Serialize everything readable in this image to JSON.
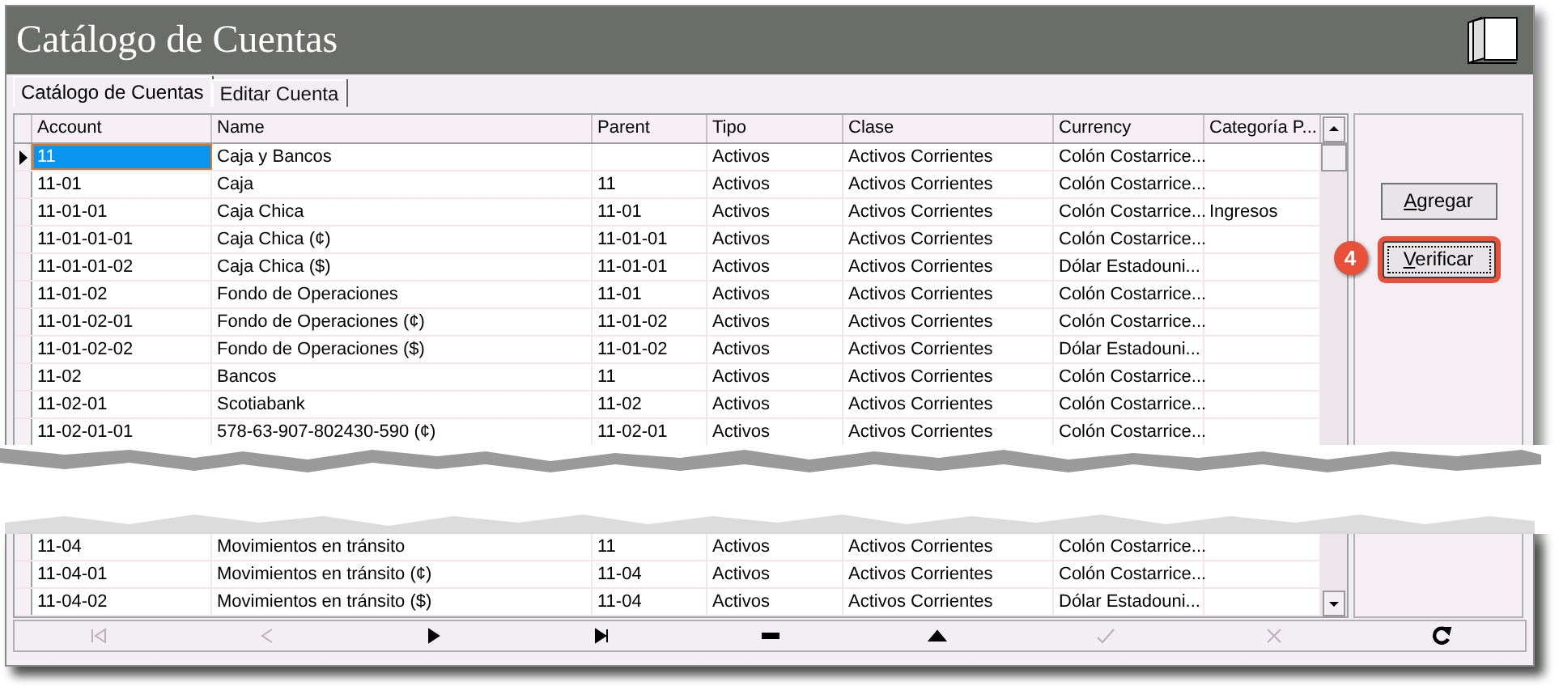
{
  "window": {
    "title": "Catálogo de Cuentas"
  },
  "tabs": [
    {
      "label": "Catálogo de Cuentas",
      "selected": true
    },
    {
      "label": "Editar Cuenta",
      "selected": false
    }
  ],
  "table": {
    "columns": [
      "Account",
      "Name",
      "Parent",
      "Tipo",
      "Clase",
      "Currency",
      "Categoría P..."
    ],
    "rows_above_tear": [
      {
        "account": "11",
        "name": "Caja y Bancos",
        "tipo": "Activos",
        "clase": "Activos Corrientes",
        "currency": "Colón Costarrice...",
        "selected": true
      },
      {
        "account": "11-01",
        "name": "Caja",
        "parent": "11",
        "tipo": "Activos",
        "clase": "Activos Corrientes",
        "currency": "Colón Costarrice...",
        "selected": false
      },
      {
        "account": "11-01-01",
        "name": "Caja Chica",
        "parent": "11-01",
        "tipo": "Activos",
        "clase": "Activos Corrientes",
        "currency": "Colón Costarrice...",
        "categoria": "Ingresos",
        "selected": false
      },
      {
        "account": "11-01-01-01",
        "name": "Caja Chica (¢)",
        "parent": "11-01-01",
        "tipo": "Activos",
        "clase": "Activos Corrientes",
        "currency": "Colón Costarrice...",
        "selected": false
      },
      {
        "account": "11-01-01-02",
        "name": "Caja Chica ($)",
        "parent": "11-01-01",
        "tipo": "Activos",
        "clase": "Activos Corrientes",
        "currency": "Dólar Estadouni...",
        "selected": false
      },
      {
        "account": "11-01-02",
        "name": "Fondo de Operaciones",
        "parent": "11-01",
        "tipo": "Activos",
        "clase": "Activos Corrientes",
        "currency": "Colón Costarrice...",
        "selected": false
      },
      {
        "account": "11-01-02-01",
        "name": "Fondo de Operaciones (¢)",
        "parent": "11-01-02",
        "tipo": "Activos",
        "clase": "Activos Corrientes",
        "currency": "Colón Costarrice...",
        "selected": false
      },
      {
        "account": "11-01-02-02",
        "name": "Fondo de Operaciones ($)",
        "parent": "11-01-02",
        "tipo": "Activos",
        "clase": "Activos Corrientes",
        "currency": "Dólar Estadouni...",
        "selected": false
      },
      {
        "account": "11-02",
        "name": "Bancos",
        "parent": "11",
        "tipo": "Activos",
        "clase": "Activos Corrientes",
        "currency": "Colón Costarrice...",
        "selected": false
      },
      {
        "account": "11-02-01",
        "name": "Scotiabank",
        "parent": "11-02",
        "tipo": "Activos",
        "clase": "Activos Corrientes",
        "currency": "Colón Costarrice...",
        "selected": false
      },
      {
        "account": "11-02-01-01",
        "name": "578-63-907-802430-590 (¢)",
        "parent": "11-02-01",
        "tipo": "Activos",
        "clase": "Activos Corrientes",
        "currency": "Colón Costarrice...",
        "selected": false
      }
    ],
    "rows_below_tear": [
      {
        "account": "11-04",
        "name": "Movimientos en tránsito",
        "parent": "11",
        "tipo": "Activos",
        "clase": "Activos Corrientes",
        "currency": "Colón Costarrice...",
        "selected": false
      },
      {
        "account": "11-04-01",
        "name": "Movimientos en tránsito (¢)",
        "parent": "11-04",
        "tipo": "Activos",
        "clase": "Activos Corrientes",
        "currency": "Colón Costarrice...",
        "selected": false
      },
      {
        "account": "11-04-02",
        "name": "Movimientos en tránsito ($)",
        "parent": "11-04",
        "tipo": "Activos",
        "clase": "Activos Corrientes",
        "currency": "Dólar Estadouni...",
        "selected": false
      }
    ]
  },
  "buttons": [
    {
      "label": "Agregar",
      "highlighted": false
    },
    {
      "label": "Verificar",
      "highlighted": true,
      "callout": "4"
    }
  ],
  "navigator": [
    {
      "kind": "first",
      "disabled": true
    },
    {
      "kind": "previous",
      "disabled": true
    },
    {
      "kind": "next",
      "disabled": false
    },
    {
      "kind": "last",
      "disabled": false
    },
    {
      "kind": "delete",
      "disabled": false
    },
    {
      "kind": "add",
      "disabled": false
    },
    {
      "kind": "confirm",
      "disabled": true
    },
    {
      "kind": "cancel",
      "disabled": true
    },
    {
      "kind": "refresh",
      "disabled": false
    }
  ]
}
